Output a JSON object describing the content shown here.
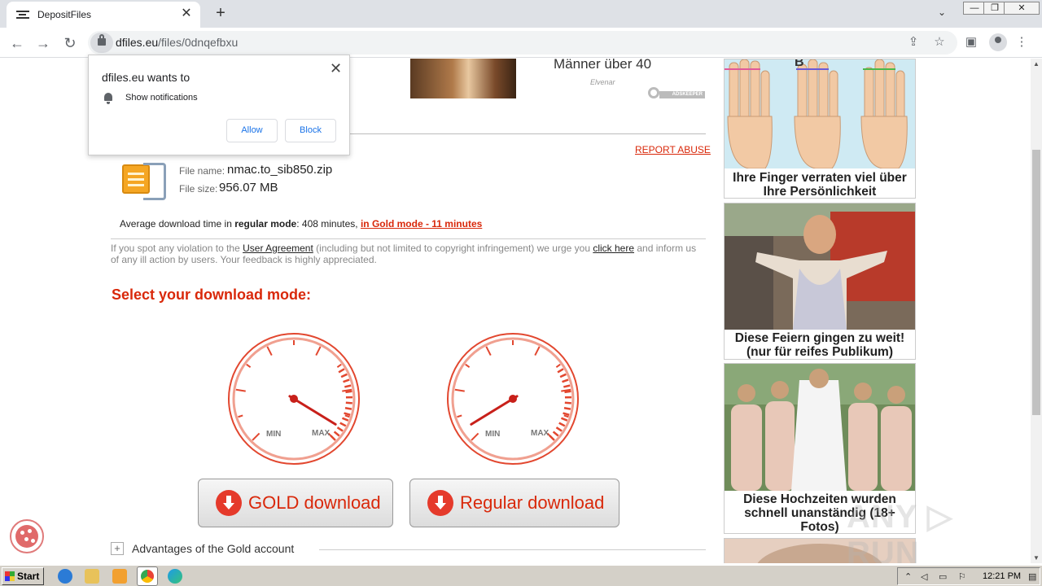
{
  "browser": {
    "tab_title": "DepositFiles",
    "tab_close": "✕",
    "new_tab": "+",
    "tab_menu": "⌄",
    "url_host": "dfiles.eu",
    "url_path": "/files/0dnqefbxu",
    "win_min": "—",
    "win_max": "❐",
    "win_close": "✕"
  },
  "notification": {
    "title": "dfiles.eu wants to",
    "close": "✕",
    "permission": "Show notifications",
    "allow": "Allow",
    "block": "Block"
  },
  "ad_top": {
    "headline": "Männer über 40",
    "source": "Elvenar",
    "network": "ADSKEEPER"
  },
  "report_abuse": "REPORT ABUSE",
  "file": {
    "name_label": "File name:",
    "name": "nmac.to_sib850.zip",
    "size_label": "File size:",
    "size": "956.07 MB"
  },
  "avg_time": {
    "prefix": "Average download time in ",
    "regular_mode": "regular mode",
    "regular_time": ": 408 minutes, ",
    "gold_link": "in Gold mode - 11 minutes"
  },
  "notice": {
    "part1": "If you spot any violation to the ",
    "link1": "User Agreement",
    "part2": " (including but not limited to copyright infringement) we urge you ",
    "link2": "click here",
    "part3": " and inform us of any ill action by users. Your feedback is highly appreciated."
  },
  "select_mode": "Select your download mode:",
  "gauges": {
    "min": "MIN",
    "max": "MAX",
    "gold_needle_level": 0.95,
    "regular_needle_level": 0.05
  },
  "buttons": {
    "gold": "GOLD download",
    "regular": "Regular download"
  },
  "advantages": {
    "plus": "+",
    "label": "Advantages of the Gold account"
  },
  "right_ads": [
    {
      "caption": "Ihre Finger verraten viel über Ihre Persönlichkeit",
      "overlay": "B"
    },
    {
      "caption": "Diese Feiern gingen zu weit! (nur für reifes Publikum)"
    },
    {
      "caption": "Diese Hochzeiten wurden schnell unanständig (18+ Fotos)"
    }
  ],
  "watermark": "ANY ▷ RUN",
  "taskbar": {
    "start": "Start",
    "time": "12:21 PM"
  },
  "colors": {
    "accent_red": "#d9280a",
    "chrome_bg": "#dee1e6",
    "taskbar": "#d4d0c8"
  }
}
